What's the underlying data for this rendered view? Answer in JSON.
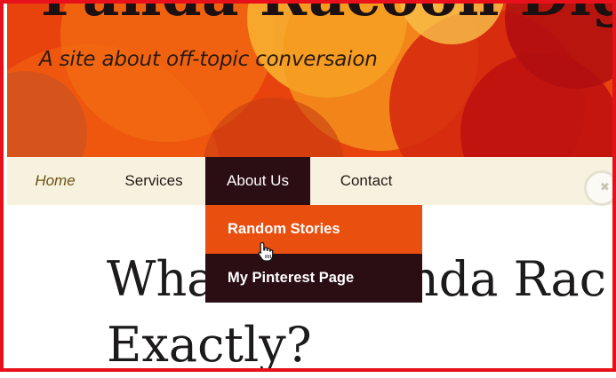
{
  "site": {
    "title": "Panda Racoon Dig",
    "tagline": "A site about off-topic conversaion"
  },
  "nav": {
    "items": [
      {
        "label": "Home"
      },
      {
        "label": "Services"
      },
      {
        "label": "About Us"
      },
      {
        "label": "Contact"
      }
    ],
    "active": "About Us",
    "dropdown": [
      {
        "label": "Random Stories"
      },
      {
        "label": "My Pinterest Page"
      }
    ]
  },
  "main": {
    "heading_line1": "What is a Panda Rac",
    "heading_line2": "Exactly?"
  },
  "icons": {
    "close": "close-icon",
    "cursor": "hand-pointer-icon"
  },
  "colors": {
    "frame_border": "#e8101a",
    "nav_bg": "#f6f2df",
    "nav_active_bg": "#2b0d14",
    "dropdown_hover_bg": "#e94f0f",
    "header_base": "#e34a0e"
  }
}
